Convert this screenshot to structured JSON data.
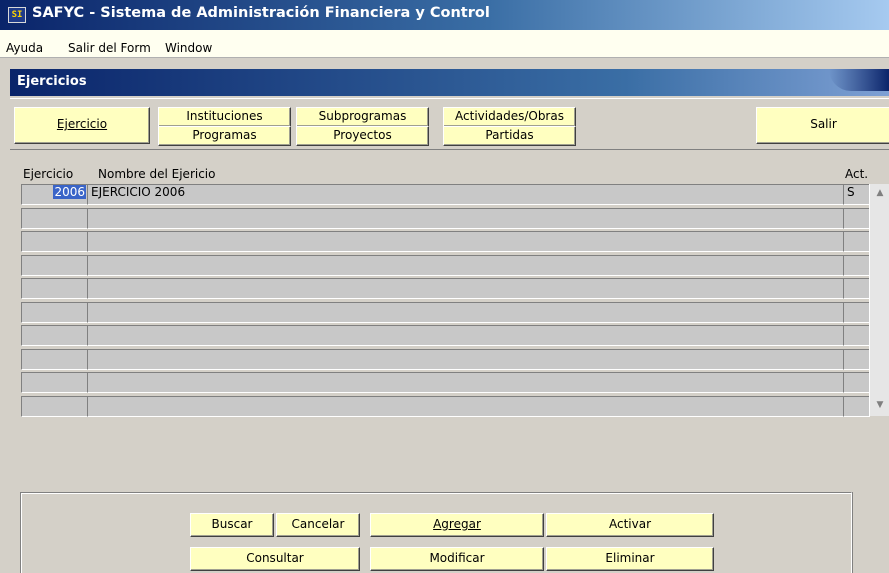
{
  "window": {
    "title": "SAFYC - Sistema de Administración Financiera y Control",
    "icon": "app-icon",
    "icon_text": "SI"
  },
  "menu": [
    {
      "label": "Ayuda"
    },
    {
      "label": "Salir del Form"
    },
    {
      "label": "Window"
    }
  ],
  "form": {
    "title": "Ejercicios"
  },
  "toolbar": {
    "ejercicio": "Ejercicio",
    "instituciones": "Instituciones",
    "programas": "Programas",
    "subprogramas": "Subprogramas",
    "proyectos": "Proyectos",
    "actividades": "Actividades/Obras",
    "partidas": "Partidas",
    "salir": "Salir"
  },
  "grid": {
    "headers": {
      "ejercicio": "Ejercicio",
      "nombre": "Nombre del Ejericio",
      "act": "Act."
    },
    "rows": [
      {
        "ejercicio": "2006",
        "nombre": "EJERCICIO 2006",
        "act": "S"
      },
      {
        "ejercicio": "",
        "nombre": "",
        "act": ""
      },
      {
        "ejercicio": "",
        "nombre": "",
        "act": ""
      },
      {
        "ejercicio": "",
        "nombre": "",
        "act": ""
      },
      {
        "ejercicio": "",
        "nombre": "",
        "act": ""
      },
      {
        "ejercicio": "",
        "nombre": "",
        "act": ""
      },
      {
        "ejercicio": "",
        "nombre": "",
        "act": ""
      },
      {
        "ejercicio": "",
        "nombre": "",
        "act": ""
      },
      {
        "ejercicio": "",
        "nombre": "",
        "act": ""
      },
      {
        "ejercicio": "",
        "nombre": "",
        "act": ""
      }
    ],
    "selected_value": "2006"
  },
  "actions": {
    "buscar": "Buscar",
    "cancelar": "Cancelar",
    "agregar": "Agregar",
    "activar": "Activar",
    "consultar": "Consultar",
    "modificar": "Modificar",
    "eliminar": "Eliminar"
  },
  "colors": {
    "titlebar_dark": "#0a246a",
    "button_face": "#ffffc0",
    "window_bg": "#d4d0c8",
    "selection": "#3a64c8"
  }
}
